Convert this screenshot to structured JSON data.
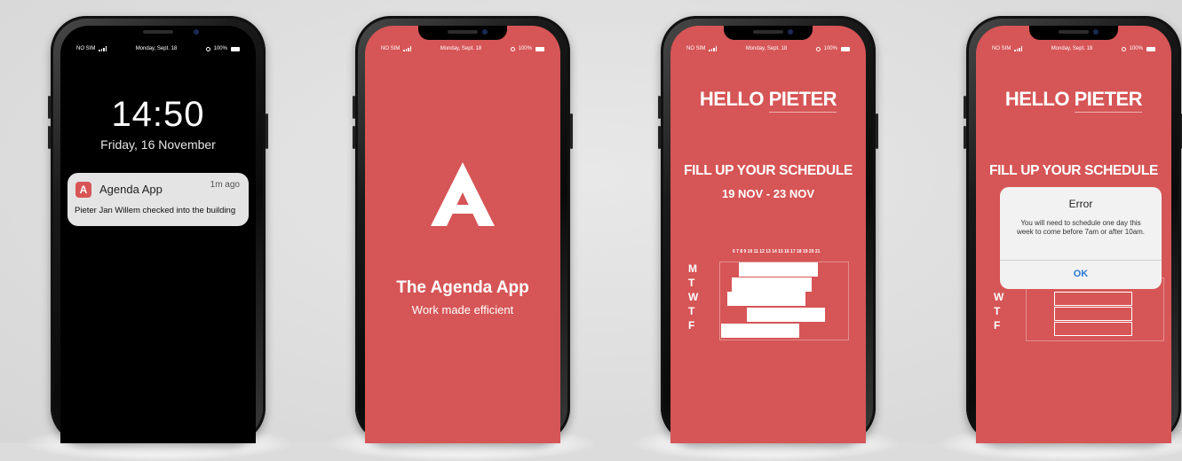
{
  "status": {
    "carrier": "NO SIM",
    "date": "Monday, Sept. 18",
    "battery": "100%"
  },
  "phone1": {
    "time": "14:50",
    "date": "Friday, 16 November",
    "notification": {
      "app_icon_letter": "A",
      "app_name": "Agenda App",
      "ago": "1m ago",
      "message": "Pieter Jan Willem checked into the building"
    }
  },
  "phone2": {
    "logo_letter": "A",
    "title": "The Agenda App",
    "subtitle": "Work made efficient"
  },
  "phone3": {
    "hello": "HELLO",
    "name": "PIETER",
    "heading": "FILL UP YOUR SCHEDULE",
    "range": "19 NOV - 23 NOV",
    "hours": "6 7 8 9 10 11 12 13 14 15 16 17 18 19 20 21",
    "days": [
      "M",
      "T",
      "W",
      "T",
      "F"
    ]
  },
  "phone4": {
    "hello": "HELLO",
    "name": "PIETER",
    "heading": "FILL UP YOUR SCHEDULE",
    "days": [
      "W",
      "T",
      "F"
    ],
    "dialog": {
      "title": "Error",
      "message": "You will need to schedule one day this week to come before 7am or after 10am.",
      "ok": "OK"
    }
  },
  "colors": {
    "brand_red": "#d65556",
    "ok_blue": "#2b7bd6"
  }
}
